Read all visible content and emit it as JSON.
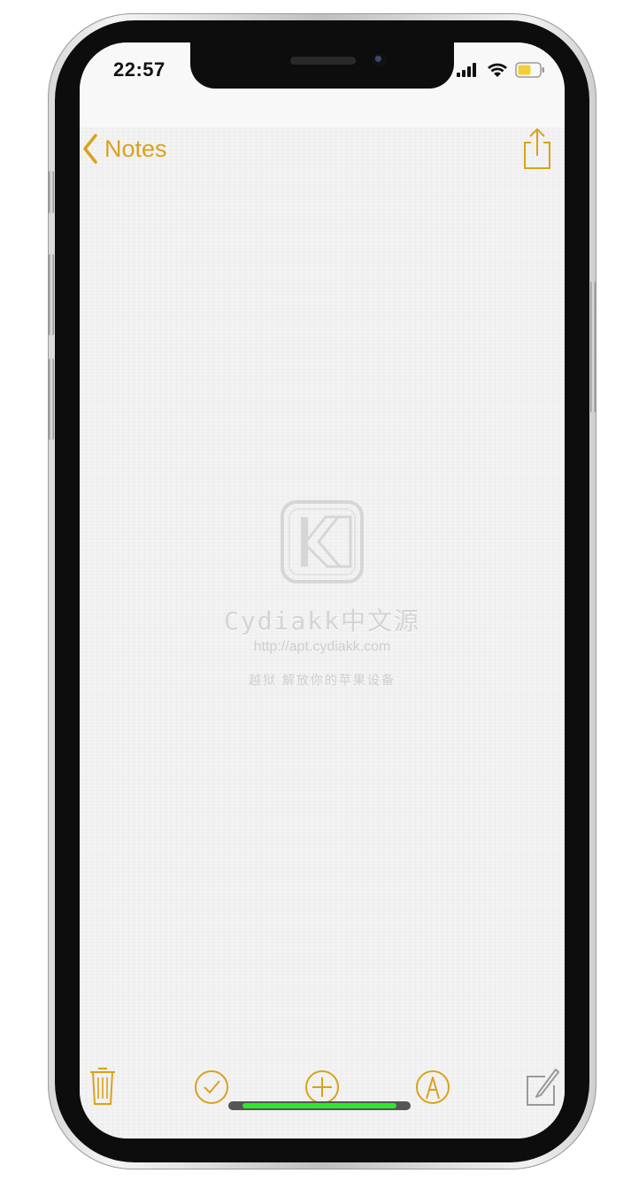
{
  "status_bar": {
    "time": "22:57",
    "icons": [
      "cellular-signal-icon",
      "wifi-icon",
      "battery-icon"
    ]
  },
  "nav": {
    "back_label": "Notes",
    "back_icon": "chevron-left-icon",
    "share_icon": "share-icon"
  },
  "watermark": {
    "title": "Cydiakk中文源",
    "url": "http://apt.cydiakk.com",
    "subtitle": "越狱 解放你的苹果设备"
  },
  "toolbar": {
    "items": [
      "trash-icon",
      "checklist-icon",
      "add-icon",
      "markup-icon",
      "compose-icon"
    ]
  },
  "colors": {
    "accent": "#d9a21b",
    "paper": "#f4f4f5",
    "home_indicator": "#2ee82e"
  }
}
